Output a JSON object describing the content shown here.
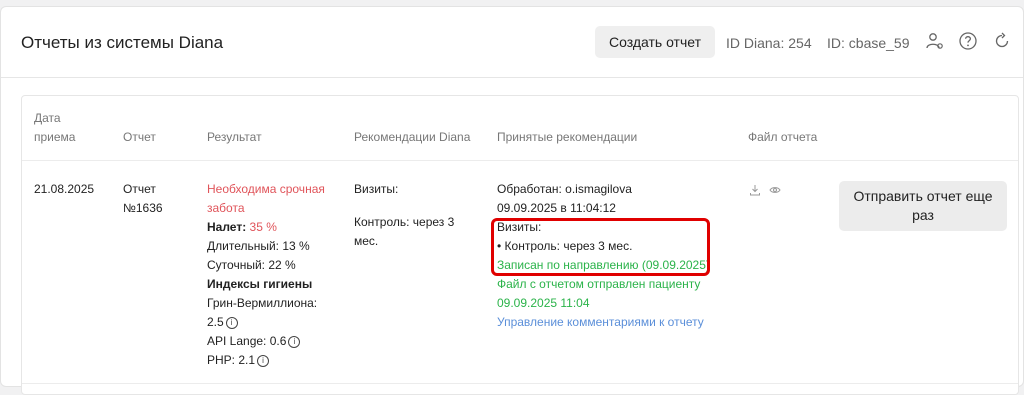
{
  "header": {
    "title": "Отчеты из системы Diana",
    "create_button": "Создать отчет",
    "id_diana": "ID Diana: 254",
    "id_cbase": "ID: cbase_59",
    "icons": [
      "user-settings-icon",
      "help-icon",
      "refresh-icon"
    ]
  },
  "table": {
    "columns": {
      "date_line1": "Дата",
      "date_line2": "приема",
      "report": "Отчет",
      "result": "Результат",
      "diana_recs": "Рекомендации Diana",
      "accepted_recs": "Принятые рекомендации",
      "file": "Файл отчета"
    },
    "row": {
      "date": "21.08.2025",
      "report_line1": "Отчет",
      "report_line2": "№1636",
      "result": {
        "urgent_line1": "Необходима срочная",
        "urgent_line2": "забота",
        "plaque_label": "Налет:",
        "plaque_value": "35 %",
        "long_term": "Длительный: 13 %",
        "daily": "Суточный: 22 %",
        "hygiene_title": "Индексы гигиены",
        "green_vermillion_label": "Грин-Вермиллиона:",
        "green_vermillion_value": "2.5",
        "api_lange": "API Lange: 0.6",
        "php": "PHP: 2.1"
      },
      "diana_recs": {
        "visits": "Визиты:",
        "control_line1": "Контроль: через 3",
        "control_line2": "мес."
      },
      "accepted": {
        "processed": "Обработан: o.ismagilova",
        "processed_time": "09.09.2025 в 11:04:12",
        "visits": "Визиты:",
        "control": "• Контроль: через 3 мес.",
        "booked": "Записан по направлению (09.09.2025)",
        "file_sent_line1": "Файл с отчетом отправлен пациенту",
        "file_sent_line2": "09.09.2025 11:04",
        "manage_comments": "Управление комментариями к отчету"
      },
      "file_icons": [
        "download-icon",
        "eye-icon"
      ],
      "send_button_line1": "Отправить отчет еще",
      "send_button_line2": "раз"
    }
  },
  "colors": {
    "urgent": "#e0545a",
    "success": "#2bb34a",
    "link": "#5b8fd9",
    "highlight": "#e00000"
  }
}
